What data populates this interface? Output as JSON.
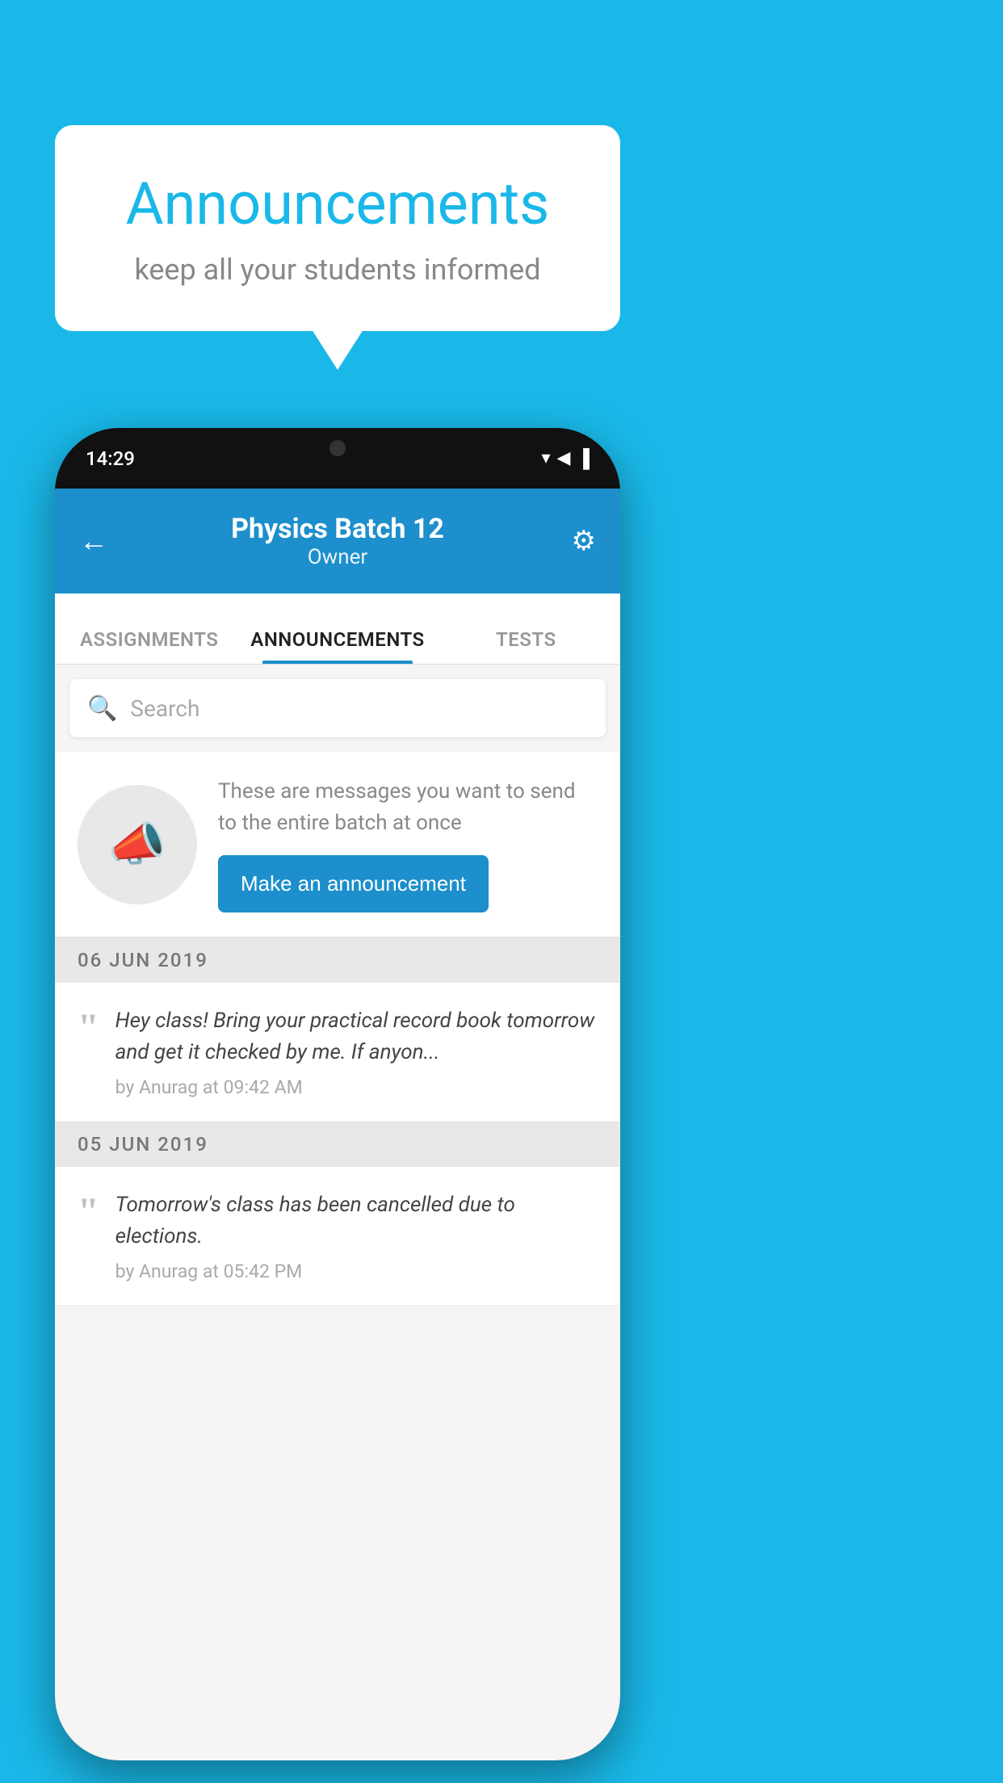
{
  "background_color": "#1ab8e8",
  "speech_bubble": {
    "title": "Announcements",
    "subtitle": "keep all your students informed"
  },
  "phone": {
    "status_bar": {
      "time": "14:29",
      "icons": [
        "▼",
        "◀",
        "▌"
      ]
    },
    "header": {
      "title": "Physics Batch 12",
      "subtitle": "Owner",
      "back_label": "←",
      "settings_label": "⚙"
    },
    "tabs": [
      {
        "label": "ASSIGNMENTS",
        "active": false
      },
      {
        "label": "ANNOUNCEMENTS",
        "active": true
      },
      {
        "label": "TESTS",
        "active": false
      }
    ],
    "search": {
      "placeholder": "Search"
    },
    "promo_card": {
      "description": "These are messages you want to send to the entire batch at once",
      "button_label": "Make an announcement"
    },
    "announcement_groups": [
      {
        "date": "06  JUN  2019",
        "items": [
          {
            "text": "Hey class! Bring your practical record book tomorrow and get it checked by me. If anyon...",
            "author": "by Anurag at 09:42 AM"
          }
        ]
      },
      {
        "date": "05  JUN  2019",
        "items": [
          {
            "text": "Tomorrow's class has been cancelled due to elections.",
            "author": "by Anurag at 05:42 PM"
          }
        ]
      }
    ]
  }
}
